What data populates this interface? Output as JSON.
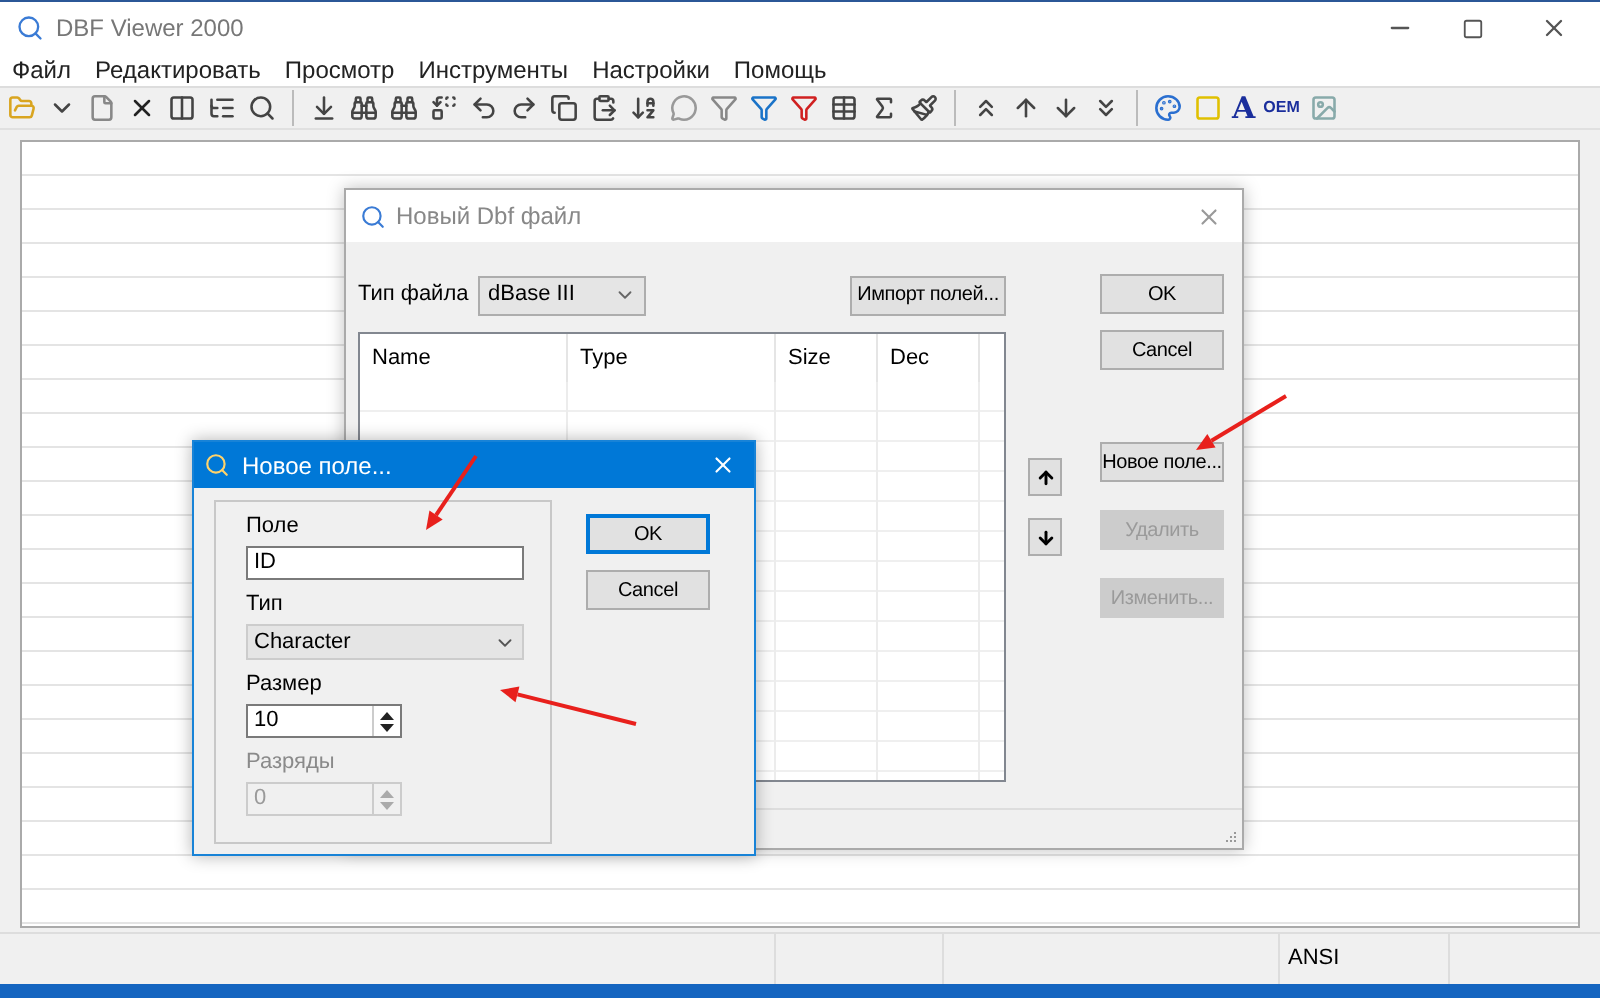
{
  "window": {
    "title": "DBF Viewer 2000"
  },
  "menu": [
    "Файл",
    "Редактировать",
    "Просмотр",
    "Инструменты",
    "Настройки",
    "Помощь"
  ],
  "toolbar": {
    "font_button": "A",
    "oem_button": "OEM"
  },
  "new_file_dialog": {
    "title": "Новый Dbf файл",
    "file_type_label": "Тип файла",
    "file_type": "dBase III",
    "import_button": "Импорт полей...",
    "ok_button": "OK",
    "cancel_button": "Cancel",
    "columns": [
      "Name",
      "Type",
      "Size",
      "Dec"
    ],
    "buttons": [
      {
        "label": "Новое поле...",
        "disabled": false
      },
      {
        "label": "Удалить",
        "disabled": true
      },
      {
        "label": "Изменить...",
        "disabled": true
      }
    ]
  },
  "new_field_dialog": {
    "title": "Новое поле...",
    "fields": [
      {
        "kind": "text",
        "label": "Поле",
        "value": "ID",
        "disabled": false
      },
      {
        "kind": "select",
        "label": "Тип",
        "value": "Character",
        "disabled": false
      },
      {
        "kind": "spinner",
        "label": "Размер",
        "value": "10",
        "disabled": false
      },
      {
        "kind": "spinner",
        "label": "Разряды",
        "value": "0",
        "disabled": true
      }
    ],
    "ok_button": "OK",
    "cancel_button": "Cancel"
  },
  "status_bar": {
    "encoding": "ANSI"
  }
}
